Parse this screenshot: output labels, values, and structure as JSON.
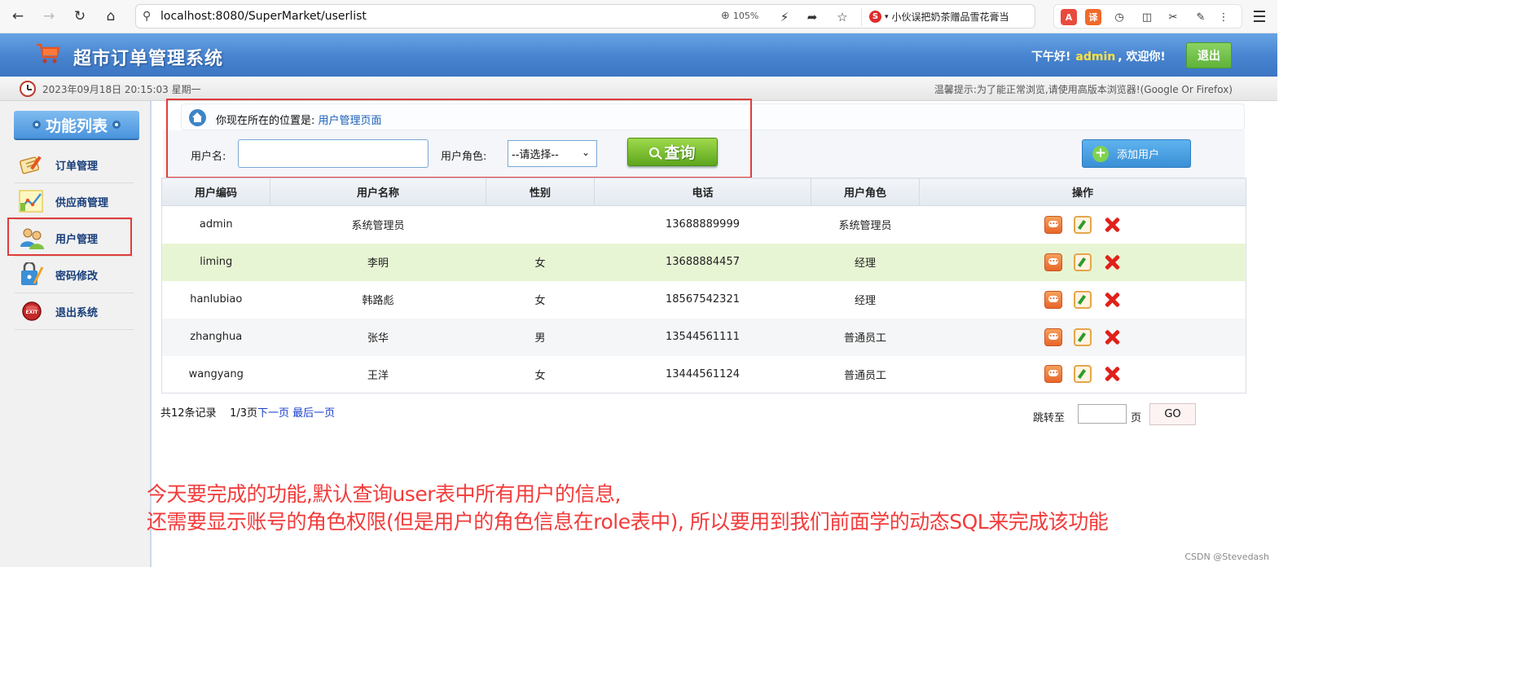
{
  "browser": {
    "url": "localhost:8080/SuperMarket/userlist",
    "zoom": "105%",
    "promo_text": "小伙误把奶茶赠品雪花膏当",
    "ext_pdf": "A",
    "ext_translate": "译"
  },
  "header": {
    "title": "超市订单管理系统",
    "greeting": "下午好!",
    "username": "admin",
    "welcome": ", 欢迎你!",
    "logout_label": "退出"
  },
  "infobar": {
    "datetime": "2023年09月18日 20:15:03 星期一",
    "tip": "温馨提示:为了能正常浏览,请使用高版本浏览器!(Google Or Firefox)"
  },
  "sidebar": {
    "title": "功能列表",
    "items": [
      {
        "label": "订单管理",
        "icon": "order-icon"
      },
      {
        "label": "供应商管理",
        "icon": "supplier-icon"
      },
      {
        "label": "用户管理",
        "icon": "users-icon"
      },
      {
        "label": "密码修改",
        "icon": "password-icon"
      },
      {
        "label": "退出系统",
        "icon": "exit-icon"
      }
    ]
  },
  "main": {
    "location_prefix": "你现在所在的位置是:",
    "location_page": "用户管理页面",
    "search": {
      "username_label": "用户名:",
      "username_value": "",
      "role_label": "用户角色:",
      "role_selected": "--请选择--",
      "query_label": "查询",
      "add_label": "添加用户"
    },
    "table": {
      "headers": [
        "用户编码",
        "用户名称",
        "性别",
        "电话",
        "用户角色",
        "操作"
      ],
      "rows": [
        {
          "code": "admin",
          "name": "系统管理员",
          "gender": "",
          "phone": "13688889999",
          "role": "系统管理员"
        },
        {
          "code": "liming",
          "name": "李明",
          "gender": "女",
          "phone": "13688884457",
          "role": "经理"
        },
        {
          "code": "hanlubiao",
          "name": "韩路彪",
          "gender": "女",
          "phone": "18567542321",
          "role": "经理"
        },
        {
          "code": "zhanghua",
          "name": "张华",
          "gender": "男",
          "phone": "13544561111",
          "role": "普通员工"
        },
        {
          "code": "wangyang",
          "name": "王洋",
          "gender": "女",
          "phone": "13444561124",
          "role": "普通员工"
        }
      ]
    },
    "pagination": {
      "total": "共12条记录",
      "current": "1/3页",
      "next": "下一页",
      "last": "最后一页",
      "jump_label": "跳转至",
      "jump_value": "",
      "page_unit": "页",
      "go_label": "GO"
    }
  },
  "annotation": {
    "line1": "今天要完成的功能,默认查询user表中所有用户的信息,",
    "line2": "还需要显示账号的角色权限(但是用户的角色信息在role表中), 所以要用到我们前面学的动态SQL来完成该功能"
  },
  "watermark": "CSDN @Stevedash",
  "colors": {
    "header_blue": "#4783cf",
    "highlight_red": "#e03c3c",
    "annotation_red": "#f23b3b",
    "username_yellow": "#ffe33a",
    "row_hover_green": "#e8f5d4"
  }
}
